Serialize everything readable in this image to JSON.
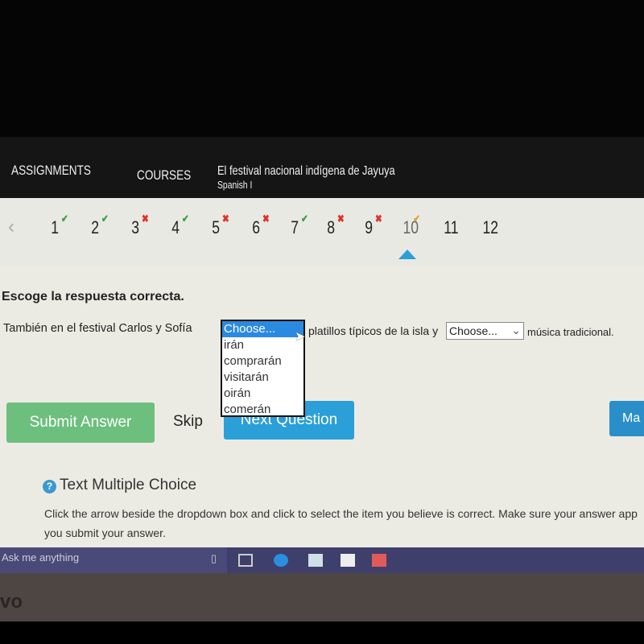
{
  "header": {
    "nav": [
      "ASSIGNMENTS",
      "COURSES"
    ],
    "title": "El festival nacional indígena de Jayuya",
    "subtitle": "Spanish I"
  },
  "questions": [
    {
      "n": "1",
      "status": "correct"
    },
    {
      "n": "2",
      "status": "correct"
    },
    {
      "n": "3",
      "status": "incorrect"
    },
    {
      "n": "4",
      "status": "correct"
    },
    {
      "n": "5",
      "status": "incorrect"
    },
    {
      "n": "6",
      "status": "incorrect"
    },
    {
      "n": "7",
      "status": "correct"
    },
    {
      "n": "8",
      "status": "incorrect"
    },
    {
      "n": "9",
      "status": "incorrect"
    },
    {
      "n": "10",
      "status": "current"
    },
    {
      "n": "11",
      "status": "none"
    },
    {
      "n": "12",
      "status": "none"
    }
  ],
  "colors": {
    "correct": "#3aa13a",
    "incorrect": "#e0302a",
    "current": "#e69a3a",
    "accent": "#2a9fd8",
    "submit": "#6cbf7c"
  },
  "question": {
    "prompt": "Escoge la respuesta correcta.",
    "part1": "También en el festival Carlos y Sofía",
    "part2": "platillos típicos de la isla y",
    "part3": "música tradicional.",
    "dropdown1": {
      "value": "Choose...",
      "options": [
        "Choose...",
        "irán",
        "comprarán",
        "visitarán",
        "oirán",
        "comerán"
      ]
    },
    "dropdown2": {
      "value": "Choose..."
    }
  },
  "buttons": {
    "submit": "Submit Answer",
    "skip": "Skip",
    "next": "Next Question",
    "mark": "Ma"
  },
  "help": {
    "title": "Text Multiple Choice",
    "text1": "Click the arrow beside the dropdown box and click to select the item you believe is correct. Make sure your answer app",
    "text2": "you submit your answer."
  },
  "taskbar": {
    "search": "Ask me anything"
  }
}
